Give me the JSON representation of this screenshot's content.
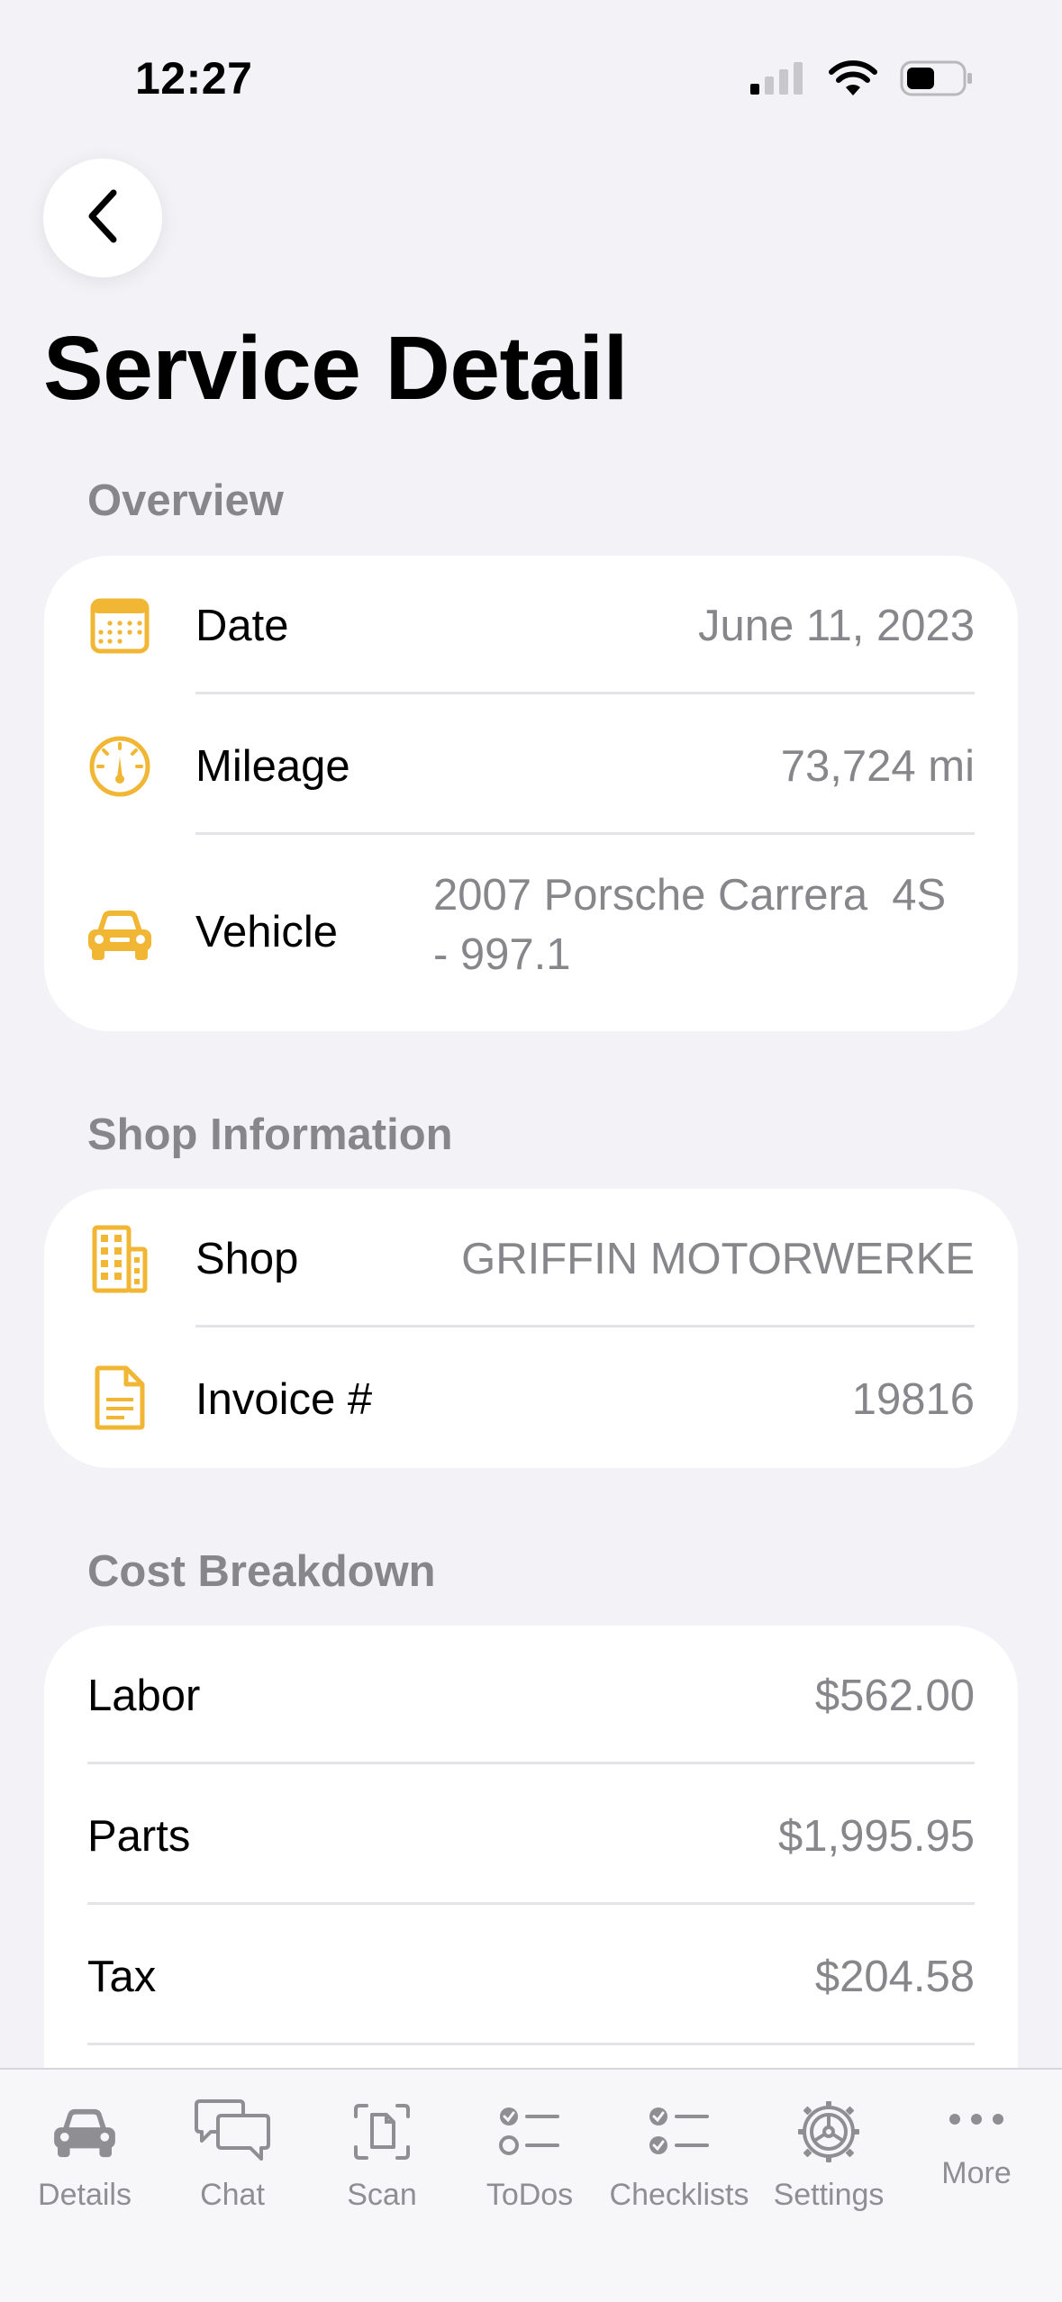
{
  "status": {
    "time": "12:27"
  },
  "nav": {
    "title": "Service Detail"
  },
  "overview": {
    "header": "Overview",
    "rows": [
      {
        "icon": "calendar-icon",
        "label": "Date",
        "value": "June 11, 2023"
      },
      {
        "icon": "speedometer-icon",
        "label": "Mileage",
        "value": "73,724 mi"
      },
      {
        "icon": "car-icon",
        "label": "Vehicle",
        "value_line1": "2007 Porsche Carrera  4S",
        "value_line2": "- 997.1"
      }
    ]
  },
  "shop": {
    "header": "Shop Information",
    "rows": [
      {
        "icon": "building-icon",
        "label": "Shop",
        "value": "GRIFFIN MOTORWERKE"
      },
      {
        "icon": "document-icon",
        "label": "Invoice #",
        "value": "19816"
      }
    ]
  },
  "cost": {
    "header": "Cost Breakdown",
    "rows": [
      {
        "label": "Labor",
        "value": "$562.00"
      },
      {
        "label": "Parts",
        "value": "$1,995.95"
      },
      {
        "label": "Tax",
        "value": "$204.58"
      }
    ]
  },
  "tabbar": {
    "tabs": [
      {
        "icon": "car-icon",
        "label": "Details"
      },
      {
        "icon": "chat-bubbles-icon",
        "label": "Chat"
      },
      {
        "icon": "scan-document-icon",
        "label": "Scan"
      },
      {
        "icon": "checklist-icon",
        "label": "ToDos"
      },
      {
        "icon": "checklist-icon",
        "label": "Checklists"
      },
      {
        "icon": "gear-icon",
        "label": "Settings"
      },
      {
        "icon": "ellipsis-icon",
        "label": "More"
      }
    ]
  },
  "colors": {
    "accent": "#F1B634",
    "background": "#F2F2F7",
    "secondary_text": "#86868B",
    "tab_inactive": "#8E8E93"
  }
}
